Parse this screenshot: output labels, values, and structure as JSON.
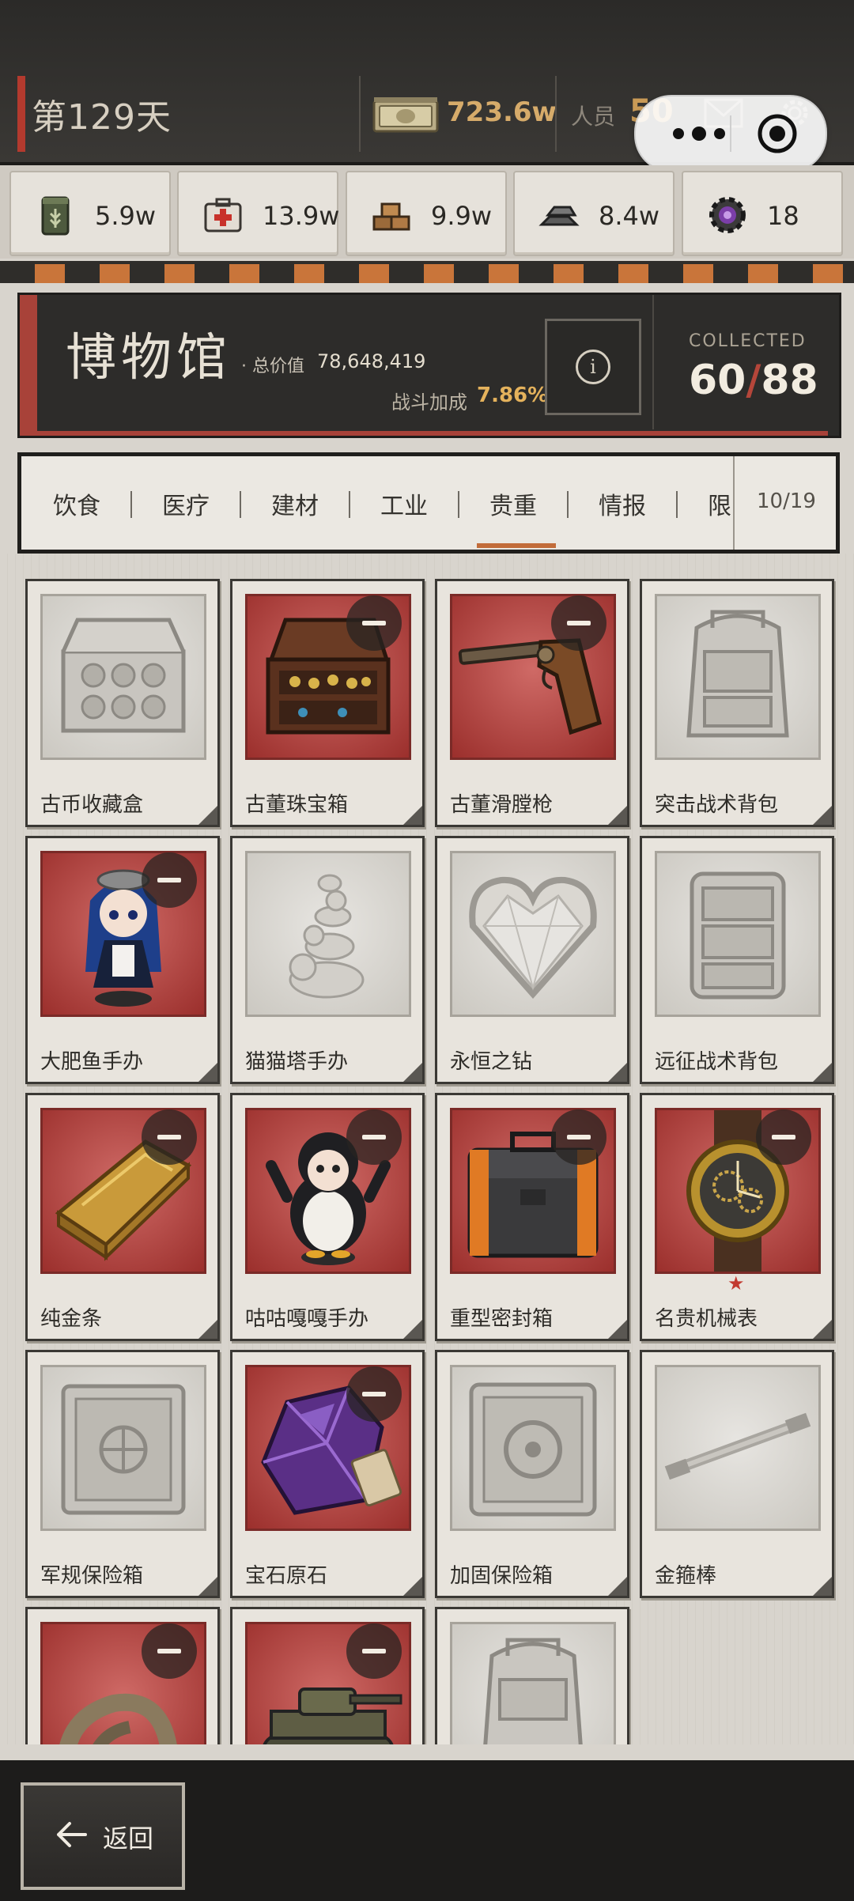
{
  "header": {
    "day": "第129天",
    "money": "723.6w",
    "staff_label": "人员",
    "staff_value": "50"
  },
  "resources": [
    {
      "icon": "food-can-icon",
      "value": "5.9w"
    },
    {
      "icon": "medkit-icon",
      "value": "13.9w"
    },
    {
      "icon": "bricks-icon",
      "value": "9.9w"
    },
    {
      "icon": "steel-ingot-icon",
      "value": "8.4w"
    },
    {
      "icon": "gear-chip-icon",
      "value": "18"
    }
  ],
  "museum": {
    "title": "博物馆",
    "total_label": "· 总价值",
    "total_value": "78,648,419",
    "bonus_label": "战斗加成",
    "bonus_value": "7.86%",
    "collected_label": "COLLECTED",
    "collected": "60",
    "collected_total": "88"
  },
  "tabs": {
    "items": [
      "饮食",
      "医疗",
      "建材",
      "工业",
      "贵重",
      "情报",
      "限"
    ],
    "active": "贵重",
    "counter": "10/19"
  },
  "items": [
    {
      "name": "古币收藏盒",
      "state": "locked",
      "icon": "coin-box-icon"
    },
    {
      "name": "古董珠宝箱",
      "state": "owned",
      "icon": "jewelry-chest-icon"
    },
    {
      "name": "古董滑膛枪",
      "state": "owned",
      "icon": "musket-icon"
    },
    {
      "name": "突击战术背包",
      "state": "locked",
      "icon": "backpack-icon"
    },
    {
      "name": "大肥鱼手办",
      "state": "owned",
      "icon": "maid-figure-icon"
    },
    {
      "name": "猫猫塔手办",
      "state": "locked",
      "icon": "cat-tower-icon"
    },
    {
      "name": "永恒之钻",
      "state": "locked",
      "icon": "diamond-heart-icon"
    },
    {
      "name": "远征战术背包",
      "state": "locked",
      "icon": "big-backpack-icon"
    },
    {
      "name": "纯金条",
      "state": "owned",
      "icon": "gold-bar-icon"
    },
    {
      "name": "咕咕嘎嘎手办",
      "state": "owned",
      "icon": "penguin-figure-icon"
    },
    {
      "name": "重型密封箱",
      "state": "owned",
      "icon": "sealed-case-icon"
    },
    {
      "name": "名贵机械表",
      "state": "owned",
      "icon": "watch-icon",
      "star": "★"
    },
    {
      "name": "军规保险箱",
      "state": "locked",
      "icon": "safe-icon"
    },
    {
      "name": "宝石原石",
      "state": "owned",
      "icon": "amethyst-icon"
    },
    {
      "name": "加固保险箱",
      "state": "locked",
      "icon": "reinforced-safe-icon"
    },
    {
      "name": "金箍棒",
      "state": "locked",
      "icon": "staff-rod-icon"
    },
    {
      "name": "",
      "state": "owned",
      "icon": "claw-icon"
    },
    {
      "name": "",
      "state": "owned",
      "icon": "tank-icon"
    },
    {
      "name": "",
      "state": "locked",
      "icon": "backpack-icon"
    }
  ],
  "footer": {
    "back_label": "返回"
  },
  "colors": {
    "accent_red": "#a84239",
    "money_gold": "#d6ab6a",
    "bonus_gold": "#e4b25c",
    "tab_underline": "#c26c3a"
  }
}
